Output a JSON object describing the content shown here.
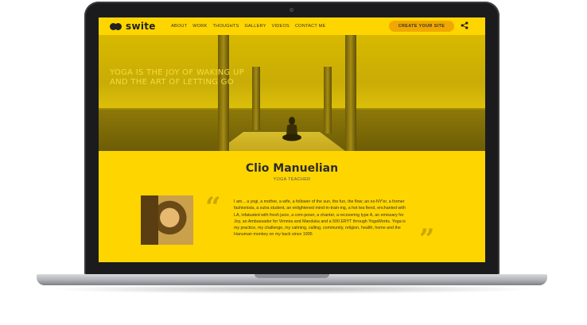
{
  "nav": {
    "logo": "swite",
    "menu": [
      "ABOUT",
      "WORK",
      "THOUGHTS",
      "GALLERY",
      "VIDEOS",
      "CONTACT ME"
    ],
    "cta": "CREATE YOUR SITE"
  },
  "hero": {
    "line1": "YOGA IS THE JOY OF WAKING UP",
    "line2": "AND THE ART OF LETTING GO"
  },
  "profile": {
    "name": "Clio Manuelian",
    "role": "YOGA TEACHER",
    "quote_open": "“",
    "quote_close": "”",
    "bio": "I am... a yogi, a mother, a wife, a follower of the sun, the fun, the flow; an ex-NY'er, a former fashionista, a sutra student, an enlightened mind-in-train-ing, a hot tea fiend, enchanted with LA, infatuated with fresh juice, a com-poser, a chanter, a recovering type A, an emissary for Joy, an Ambassador for Vimmia and Manduka and a 500 ERYT through YogaWorks. Yoga is my practice, my challenge, my calming, calling, community, religion, health, home and the Hanuman monkey on my back since 1995"
  },
  "colors": {
    "accent": "#ffd500",
    "cta": "#f0a800",
    "text": "#2c2c2c"
  }
}
